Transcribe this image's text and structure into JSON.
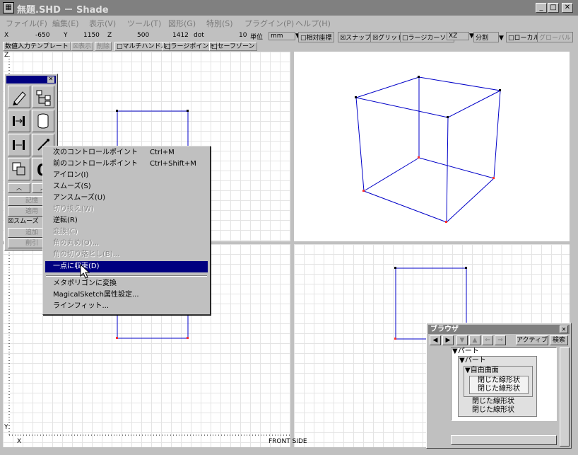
{
  "window": {
    "title": "無題.SHD － Shade",
    "app_icon": "shade-app-icon",
    "controls": [
      "minimize-icon",
      "maximize-icon",
      "close-icon"
    ]
  },
  "menu": [
    "ファイル(F)",
    "編集(E)",
    "表示(V)",
    "ツール(T)",
    "図形(G)",
    "特別(S)",
    "プラグイン(P)",
    "ヘルプ(H)"
  ],
  "coords": {
    "x_label": "X",
    "x_value": "-650",
    "y_label": "Y",
    "y_value": "1150",
    "z_label": "Z",
    "z_value": "500",
    "dot_value": "1412",
    "dot_label": "dot",
    "unit_num": "10",
    "unit_label": "単位",
    "unit_value": "mm",
    "relative": "□相対座標",
    "snap": "☒スナップ",
    "grid": "☒グリッド",
    "large_cursor": "□ラージカーソル",
    "plane": "XZ",
    "divide": "分割",
    "local": "□ローカル",
    "global": "グローバル"
  },
  "options": {
    "numeric_template": "数値入力テンプレート",
    "display": "☒表示",
    "delete": "削除",
    "multi_handle": "□マルチハンドル",
    "large_point": "□ラージポイント",
    "safe_zone": "□セーフゾーン"
  },
  "palette": {
    "memory": "記憶",
    "apply": "適用",
    "smooth": "☒スムーズ",
    "add": "追加",
    "delete": "削引"
  },
  "context_menu": [
    {
      "label": "次のコントロールポイント",
      "shortcut": "Ctrl+M",
      "state": "normal"
    },
    {
      "label": "前のコントロールポイント",
      "shortcut": "Ctrl+Shift+M",
      "state": "normal"
    },
    {
      "label": "アイロン(I)",
      "shortcut": "",
      "state": "normal"
    },
    {
      "label": "スムーズ(S)",
      "shortcut": "",
      "state": "normal"
    },
    {
      "label": "アンスムーズ(U)",
      "shortcut": "",
      "state": "normal"
    },
    {
      "label": "切り換え(W)",
      "shortcut": "",
      "state": "disabled"
    },
    {
      "label": "逆転(R)",
      "shortcut": "",
      "state": "normal"
    },
    {
      "label": "変換(C)",
      "shortcut": "",
      "state": "disabled"
    },
    {
      "label": "角の丸め(O)...",
      "shortcut": "",
      "state": "disabled"
    },
    {
      "label": "角の切り落とし(B)...",
      "shortcut": "",
      "state": "disabled"
    },
    {
      "label": "一点に収束(D)",
      "shortcut": "",
      "state": "selected"
    },
    {
      "label": "メタポリゴンに変換",
      "shortcut": "",
      "state": "normal"
    },
    {
      "label": "MagicalSketch属性設定...",
      "shortcut": "",
      "state": "normal"
    },
    {
      "label": "ラインフィット...",
      "shortcut": "",
      "state": "normal"
    }
  ],
  "views": {
    "top_axis": "Z",
    "bottom_axis_y": "Y",
    "bottom_axis_x": "X",
    "front_label": "FRONT SIDE"
  },
  "browser": {
    "title": "ブラウザ",
    "active": "アクティブ",
    "search": "検索",
    "tree": [
      "▼パート",
      "▼パート",
      "▼自由曲面",
      "閉じた線形状",
      "閉じた線形状",
      "閉じた線形状",
      "閉じた線形状"
    ]
  },
  "colors": {
    "selection": "#000080",
    "wireframe": "#0000c8",
    "point": "#ff3030"
  }
}
